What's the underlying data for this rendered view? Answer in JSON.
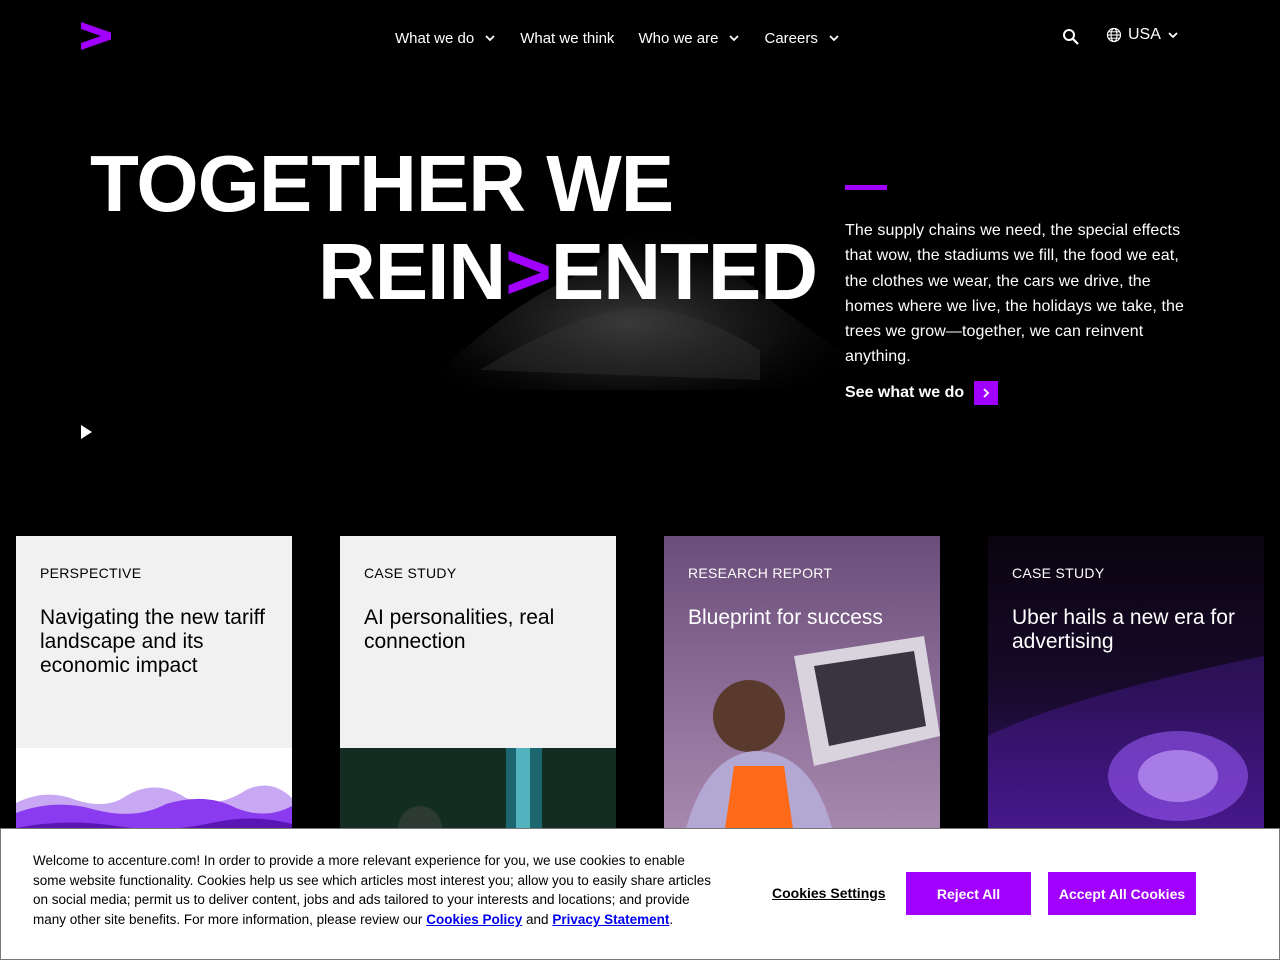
{
  "header": {
    "logo_alt": "Accenture",
    "nav": [
      {
        "label": "What we do",
        "has_dropdown": true
      },
      {
        "label": "What we think",
        "has_dropdown": false
      },
      {
        "label": "Who we are",
        "has_dropdown": true
      },
      {
        "label": "Careers",
        "has_dropdown": true
      }
    ],
    "search_icon": "search-icon",
    "locale": "USA"
  },
  "hero": {
    "title_line1": "TOGETHER WE",
    "title_line2_pre": "REIN",
    "title_line2_mark": ">",
    "title_line2_post": "ENTED",
    "body": "The supply chains we need, the special effects that wow, the stadiums we fill, the food we eat, the clothes we wear, the cars we drive, the homes where we live, the holidays we take, the trees we grow—together, we can reinvent anything.",
    "cta_label": "See what we do"
  },
  "cards": [
    {
      "eyebrow": "PERSPECTIVE",
      "title": "Navigating the new tariff landscape and its economic impact"
    },
    {
      "eyebrow": "CASE STUDY",
      "title": "AI personalities, real connection"
    },
    {
      "eyebrow": "RESEARCH REPORT",
      "title": "Blueprint for success"
    },
    {
      "eyebrow": "CASE STUDY",
      "title": "Uber hails a new era for advertising"
    }
  ],
  "cookie": {
    "text_before": "Welcome to accenture.com! In order to provide a more relevant experience for you, we use cookies to enable some website functionality. Cookies help us see which articles most interest you; allow you to easily share articles on social media; permit us to deliver content, jobs and ads tailored to your interests and locations; and provide many other site benefits. For more information, please review our",
    "policy_link": "Cookies Policy",
    "text_and": "and",
    "privacy_link": "Privacy Statement",
    "text_end": ".",
    "settings_label": "Cookies Settings",
    "reject_label": "Reject All",
    "accept_label": "Accept All Cookies"
  },
  "colors": {
    "accent": "#a100ff",
    "background": "#000000",
    "card_light": "#f1f1f1"
  }
}
